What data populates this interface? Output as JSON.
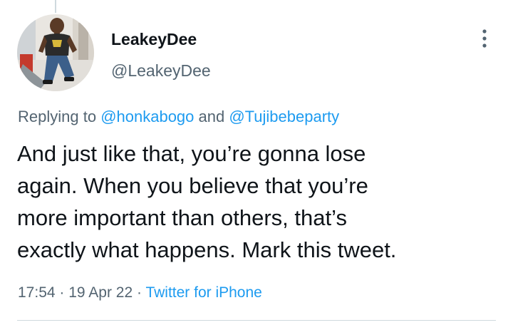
{
  "tweet": {
    "author": {
      "display_name": "LeakeyDee",
      "handle": "@LeakeyDee",
      "avatar_icon": "profile-photo"
    },
    "more_icon": "more-vertical-icon",
    "reply_context": {
      "prefix": "Replying to ",
      "mentions": [
        "@honkabogo",
        "@Tujibebeparty"
      ],
      "joiner": " and "
    },
    "text_lines": [
      "And just like that, you’re gonna lose",
      "again. When you believe that you’re",
      "more important than others, that’s",
      "exactly what happens. Mark this tweet."
    ],
    "time": "17:54",
    "separator": " · ",
    "date": "19 Apr 22",
    "source": "Twitter for iPhone"
  },
  "colors": {
    "text": "#0f1419",
    "secondary": "#536471",
    "link": "#1d9bf0",
    "divider": "#cfd9de"
  }
}
